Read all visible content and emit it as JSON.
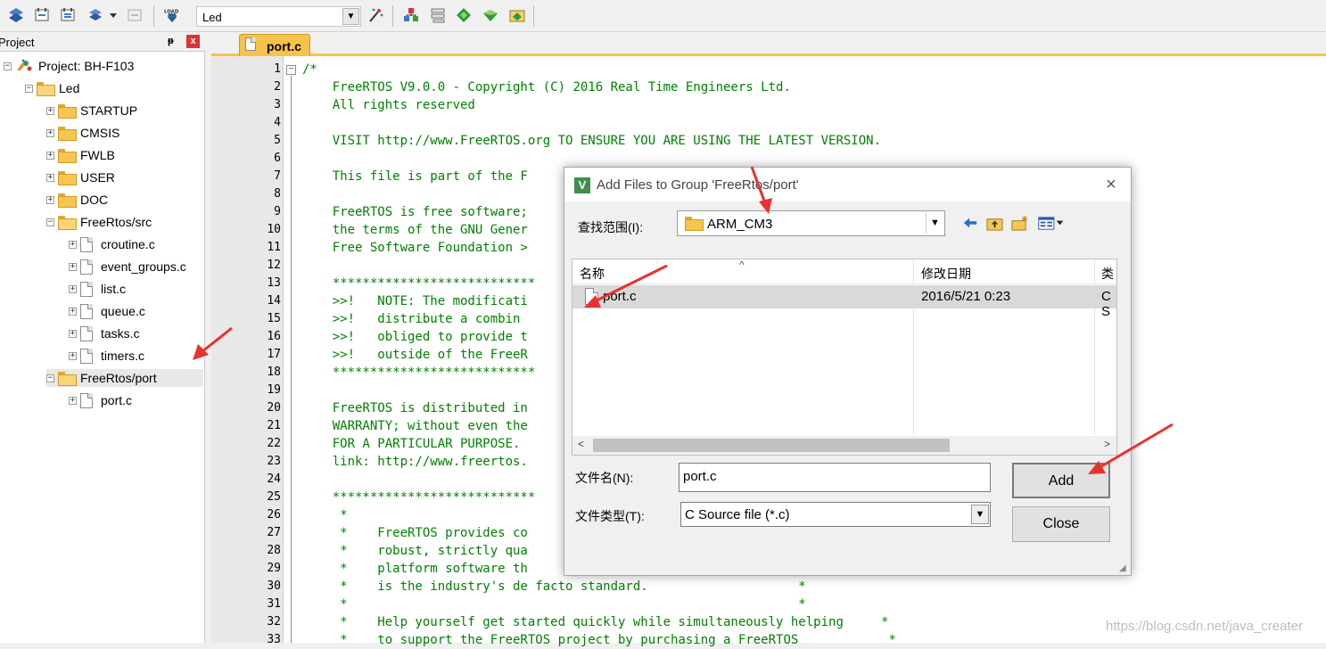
{
  "toolbar": {
    "target_name": "Led",
    "load_label": "LOAD"
  },
  "project_panel": {
    "title": "Project",
    "pin_glyph": "ᵽ",
    "close_glyph": "x",
    "tree": {
      "project": "Project: BH-F103",
      "target": "Led",
      "groups": [
        "STARTUP",
        "CMSIS",
        "FWLB",
        "USER",
        "DOC",
        "FreeRtos/src"
      ],
      "src_files": [
        "croutine.c",
        "event_groups.c",
        "list.c",
        "queue.c",
        "tasks.c",
        "timers.c"
      ],
      "port_group": "FreeRtos/port",
      "port_files": [
        "port.c"
      ]
    }
  },
  "editor": {
    "tab_label": "port.c",
    "lines": [
      {
        "n": "1",
        "text": "/*"
      },
      {
        "n": "2",
        "text": "    FreeRTOS V9.0.0 - Copyright (C) 2016 Real Time Engineers Ltd."
      },
      {
        "n": "3",
        "text": "    All rights reserved"
      },
      {
        "n": "4",
        "text": ""
      },
      {
        "n": "5",
        "text": "    VISIT http://www.FreeRTOS.org TO ENSURE YOU ARE USING THE LATEST VERSION."
      },
      {
        "n": "6",
        "text": ""
      },
      {
        "n": "7",
        "text": "    This file is part of the F"
      },
      {
        "n": "8",
        "text": ""
      },
      {
        "n": "9",
        "text": "    FreeRTOS is free software;"
      },
      {
        "n": "10",
        "text": "    the terms of the GNU Gener"
      },
      {
        "n": "11",
        "text": "    Free Software Foundation >"
      },
      {
        "n": "12",
        "text": ""
      },
      {
        "n": "13",
        "text": "    ***************************"
      },
      {
        "n": "14",
        "text": "    >>!   NOTE: The modificati"
      },
      {
        "n": "15",
        "text": "    >>!   distribute a combin"
      },
      {
        "n": "16",
        "text": "    >>!   obliged to provide t"
      },
      {
        "n": "17",
        "text": "    >>!   outside of the FreeR"
      },
      {
        "n": "18",
        "text": "    ***************************"
      },
      {
        "n": "19",
        "text": ""
      },
      {
        "n": "20",
        "text": "    FreeRTOS is distributed in"
      },
      {
        "n": "21",
        "text": "    WARRANTY; without even the"
      },
      {
        "n": "22",
        "text": "    FOR A PARTICULAR PURPOSE."
      },
      {
        "n": "23",
        "text": "    link: http://www.freertos."
      },
      {
        "n": "24",
        "text": ""
      },
      {
        "n": "25",
        "text": "    ***************************"
      },
      {
        "n": "26",
        "text": "     *"
      },
      {
        "n": "27",
        "text": "     *    FreeRTOS provides co"
      },
      {
        "n": "28",
        "text": "     *    robust, strictly qua"
      },
      {
        "n": "29",
        "text": "     *    platform software th"
      },
      {
        "n": "30",
        "text": "     *    is the industry's de facto standard.                    *"
      },
      {
        "n": "31",
        "text": "     *                                                            *"
      },
      {
        "n": "32",
        "text": "     *    Help yourself get started quickly while simultaneously helping     *"
      },
      {
        "n": "33",
        "text": "     *    to support the FreeRTOS project by purchasing a FreeRTOS            *"
      }
    ]
  },
  "dialog": {
    "app_icon_letter": "V",
    "title": "Add Files to Group 'FreeRtos/port'",
    "close_glyph": "×",
    "look_in_label": "查找范围(I):",
    "look_in_value": "ARM_CM3",
    "columns": [
      "名称",
      "修改日期",
      "类"
    ],
    "files": [
      {
        "name": "port.c",
        "date": "2016/5/21 0:23",
        "type": "C S"
      }
    ],
    "filename_label": "文件名(N):",
    "filename_value": "port.c",
    "filetype_label": "文件类型(T):",
    "filetype_value": "C Source file (*.c)",
    "add_label": "Add",
    "close_label": "Close"
  },
  "watermark": "https://blog.csdn.net/java_creater",
  "colors": {
    "annotation_arrow": "#e8322d",
    "code_comment": "#008000",
    "active_tab": "#f7c24a"
  }
}
